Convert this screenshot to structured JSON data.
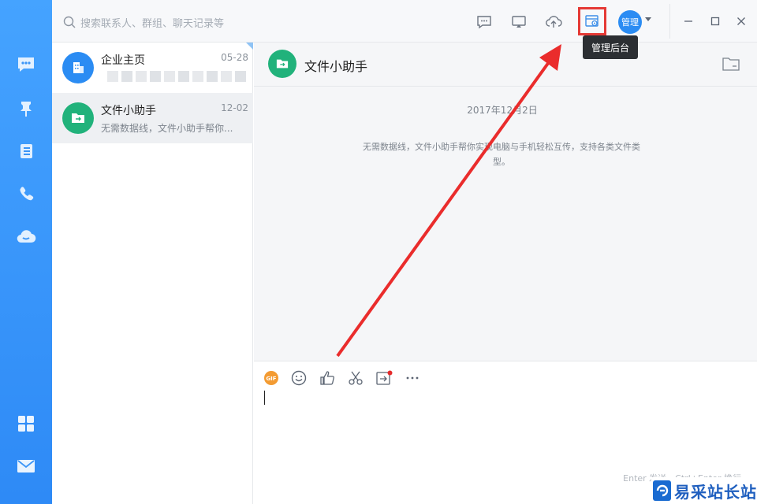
{
  "search": {
    "placeholder": "搜索联系人、群组、聊天记录等"
  },
  "toolbar": {
    "items": [
      {
        "name": "message-icon"
      },
      {
        "name": "screen-share-icon"
      },
      {
        "name": "cloud-upload-icon"
      },
      {
        "name": "admin-console-icon"
      }
    ],
    "avatar_label": "管理",
    "tooltip": "管理后台"
  },
  "rail": {
    "items": [
      "chat-icon",
      "pin-icon",
      "contacts-icon",
      "phone-icon",
      "cloud-icon",
      "apps-grid-icon",
      "mail-icon"
    ]
  },
  "sessions": [
    {
      "name": "企业主页",
      "date": "05-28",
      "preview": "",
      "avatar_color": "#2b8cf3",
      "icon": "building-icon"
    },
    {
      "name": "文件小助手",
      "date": "12-02",
      "preview": "无需数据线，文件小助手帮你...",
      "avatar_color": "#21b27b",
      "icon": "folder-icon"
    }
  ],
  "chat": {
    "title": "文件小助手",
    "date": "2017年12月2日",
    "system_message": "无需数据线，文件小助手帮你实现电脑与手机轻松互传，支持各类文件类型。",
    "send_hint": "Enter 发送，Ctrl+Enter 换行",
    "tools": [
      "gif-icon",
      "emoji-icon",
      "thumbs-up-icon",
      "scissors-icon",
      "send-file-icon",
      "more-icon"
    ]
  },
  "colors": {
    "rail": "#2e8af6",
    "accent_blue": "#2b8cf3",
    "accent_green": "#21b27b",
    "highlight_red": "#e53935"
  },
  "watermark": {
    "text": "易采站长站"
  }
}
